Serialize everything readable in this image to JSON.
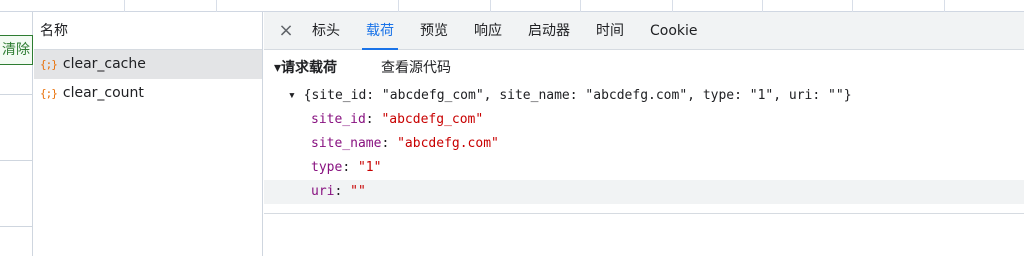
{
  "left_page": {
    "clear_label": "清除"
  },
  "name_pane": {
    "header": "名称",
    "requests": [
      {
        "icon": "{;}",
        "name": "clear_cache",
        "selected": true
      },
      {
        "icon": "{;}",
        "name": "clear_count",
        "selected": false
      }
    ]
  },
  "tabs": {
    "close": "×",
    "items": [
      "标头",
      "载荷",
      "预览",
      "响应",
      "启动器",
      "时间",
      "Cookie"
    ],
    "active": "载荷"
  },
  "payload": {
    "section_title": "▾请求载荷",
    "view_source": "查看源代码",
    "summary": "▾ {site_id: \"abcdefg_com\", site_name: \"abcdefg.com\", type: \"1\", uri: \"\"}",
    "fields": [
      {
        "key": "site_id",
        "value": "\"abcdefg_com\""
      },
      {
        "key": "site_name",
        "value": "\"abcdefg.com\""
      },
      {
        "key": "type",
        "value": "\"1\""
      },
      {
        "key": "uri",
        "value": "\"\""
      }
    ]
  },
  "colors": {
    "accent": "#1a73e8",
    "key": "#881280",
    "string": "#c80000",
    "xhr_icon": "#e8710a",
    "clear_button": "#2e7d32"
  }
}
